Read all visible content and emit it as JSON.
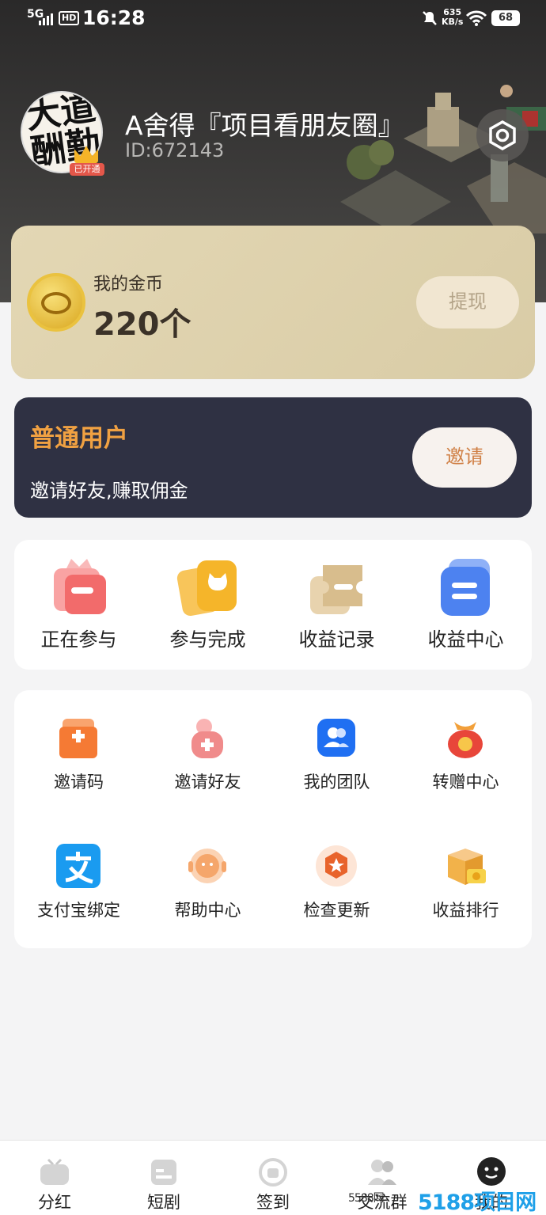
{
  "status_bar": {
    "network": "5G",
    "hd": "HD",
    "time": "16:28",
    "speed_value": "635",
    "speed_unit": "KB/s",
    "battery": "68"
  },
  "profile": {
    "name": "A舍得『项目看朋友圈』",
    "id": "ID:672143",
    "avatar_text": "大道酬勤",
    "badge": "已开通"
  },
  "coins": {
    "title": "我的金币",
    "amount": "220个",
    "withdraw_label": "提现"
  },
  "membership": {
    "level": "普通用户",
    "description": "邀请好友,赚取佣金",
    "invite_label": "邀请"
  },
  "quick_actions": [
    {
      "label": "正在参与",
      "icon": "gift-box-icon",
      "color": "#f26b6b"
    },
    {
      "label": "参与完成",
      "icon": "cat-card-icon",
      "color": "#f5b52a"
    },
    {
      "label": "收益记录",
      "icon": "ticket-icon",
      "color": "#d8bd8d"
    },
    {
      "label": "收益中心",
      "icon": "list-icon",
      "color": "#4d82f0"
    }
  ],
  "tools": [
    {
      "label": "邀请码",
      "icon": "plus-bag-icon",
      "color": "#f57a34"
    },
    {
      "label": "邀请好友",
      "icon": "add-friend-icon",
      "color": "#f08b8b"
    },
    {
      "label": "我的团队",
      "icon": "team-icon",
      "color": "#1f6ff2"
    },
    {
      "label": "转赠中心",
      "icon": "lucky-bag-icon",
      "color": "#e8463a"
    },
    {
      "label": "支付宝绑定",
      "icon": "alipay-icon",
      "color": "#1a9bf0"
    },
    {
      "label": "帮助中心",
      "icon": "headset-icon",
      "color": "#f5a66b"
    },
    {
      "label": "检查更新",
      "icon": "badge-star-icon",
      "color": "#e8632b"
    },
    {
      "label": "收益排行",
      "icon": "coin-box-icon",
      "color": "#f2b24a"
    }
  ],
  "tabbar": [
    {
      "label": "分红",
      "icon": "tv-icon"
    },
    {
      "label": "短剧",
      "icon": "folder-icon"
    },
    {
      "label": "签到",
      "icon": "checkin-icon"
    },
    {
      "label": "交流群",
      "icon": "group-chat-icon"
    },
    {
      "label": "我的",
      "icon": "face-icon"
    }
  ],
  "watermark": {
    "sub": "5588网",
    "main": "5188项目网"
  }
}
